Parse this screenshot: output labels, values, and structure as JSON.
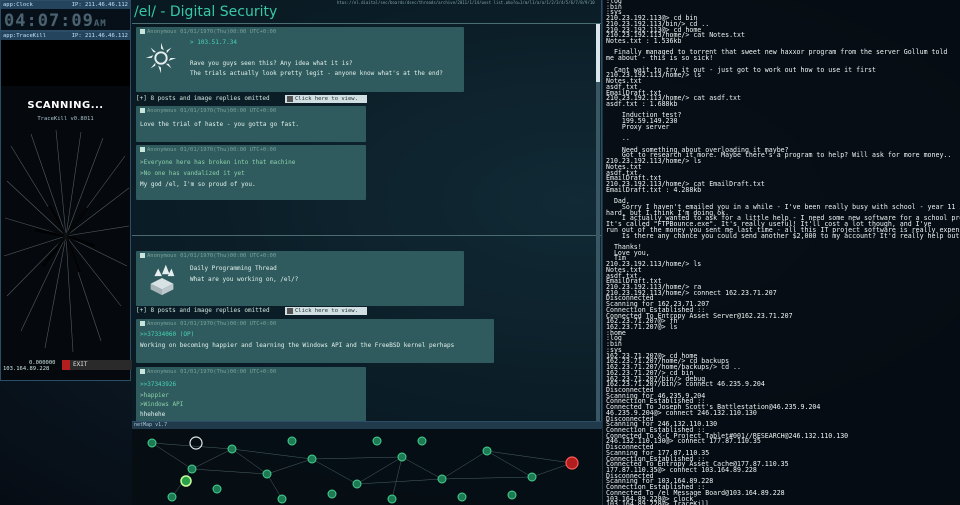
{
  "clock_module": {
    "title": "app:Clock",
    "ip": "IP: 211.46.46.112",
    "time": "04:07:09",
    "ampm": "AM"
  },
  "trace_module": {
    "title": "app:TraceKill",
    "ip": "IP: 211.46.46.112",
    "scanning": "SCANNING...",
    "version": "TraceKill v0.8011",
    "value": "0.000000",
    "ip_footer": "103.164.89.228",
    "exit": "EXIT"
  },
  "web": {
    "board_title": "/el/ - Digital Security",
    "url_strip": "htps://el.digital/sec/boards/dsec/threads/archive/2011/1/14/post_list.php?q=1/m/l1/a/a/1/2/3/4/5/6/7/8/9/10",
    "posts": [
      {
        "meta": "Anonymous 01/01/1970(Thu)00:00 UTC+0:00",
        "id": "> 103.51.7.34",
        "lines": [
          "Rave you guys seen this? Any idea what it is?",
          "The trials actually look pretty legit - anyone know what's at the end?"
        ]
      },
      {
        "meta": "Anonymous 01/01/1970(Thu)00:00 UTC+0:00",
        "lines": [
          "Love the trial of haste - you gotta go fast."
        ]
      },
      {
        "meta": "Anonymous 01/01/1970(Thu)00:00 UTC+0:00",
        "green": [
          ">Everyone here has broken into that machine",
          ">No one has vandalized it yet"
        ],
        "lines": [
          "My god /el, I'm so proud of you."
        ]
      },
      {
        "meta": "Anonymous 01/01/1970(Thu)00:00 UTC+0:00",
        "lines": [
          "Daily Programming Thread",
          "What are you working on, /el/?"
        ]
      },
      {
        "meta": "Anonymous 01/01/1970(Thu)00:00 UTC+0:00",
        "id": ">>37334060 (OP)",
        "lines": [
          "Working on becoming happier and learning the Windows API and the FreeBSD kernel perhaps"
        ]
      },
      {
        "meta": "Anonymous 01/01/1970(Thu)00:00 UTC+0:00",
        "id": ">>37343926",
        "green": [
          ">happier",
          ">Windows API"
        ],
        "lines": [
          "hhehehe"
        ]
      }
    ],
    "omitted": "[+] 8 posts and image replies omitted",
    "view_button": "Click here to view."
  },
  "netmap": {
    "title": "netMap v1.7"
  },
  "terminal": {
    "lines": [
      ":log",
      ":bin",
      ":sys",
      "210.23.192.113@> cd bin",
      "210.23.192.113/bin/> cd ..",
      "210.23.192.113@> cd home",
      "210.23.192.113/home/> cat Notes.txt",
      "Notes.txt : 1.536kb",
      "",
      "  Finally managed to torrent that sweet new haxxor program from the server Gollum told",
      "me about - this is so sick!",
      "",
      "  Cant wait to try it out - just got to work out how to use it first",
      "210.23.192.113/home/> ls",
      "Notes.txt",
      "asdf.txt",
      "EmailDraft.txt",
      "210.23.192.113/home/> cat asdf.txt",
      "asdf.txt : 1.688kb",
      "",
      "    Induction test?",
      "    199.59.149.230",
      "    Proxy server",
      "",
      "    ..",
      "",
      "    Need something about overloading it maybe?",
      "    Got to research it more. Maybe there's a program to help? Will ask for more money..",
      "210.23.192.113/home/> ls",
      "Notes.txt",
      "asdf.txt",
      "EmailDraft.txt",
      "210.23.192.113/home/> cat EmailDraft.txt",
      "EmailDraft.txt : 4.288kb",
      "",
      "  Dad,",
      "    Sorry I haven't emailed you in a while - I've been really busy with school - year 11 is",
      "hard, but I think I'm doing ok.",
      "    I actually wanted to ask for a little help - I need some new software for a school project",
      "It's called \"FTPBounce.exe\". It's really useful! It'll cost a lot though, and I've",
      "run out of the money you sent me last time - all this IT project software is really expensive",
      "    Is there any chance you could send another $2,000 to my account? It'd really help out.",
      "",
      "  Thanks!",
      "  Love you,",
      "  Tim",
      "210.23.192.113/home/> ls",
      "Notes.txt",
      "asdf.txt",
      "EmailDraft.txt",
      "210.23.192.113/home/> ra",
      "210.23.192.113/home/> connect 162.23.71.207",
      "Disconnected",
      "Scanning for 162.23.71.207",
      "Connection Established ::",
      "Connected To Entropy Asset Server@162.23.71.207",
      "162.23.71.207@> fh",
      "162.23.71.207@> ls",
      ":home",
      ":log",
      ":bin",
      ":sys",
      "162.23.71.207@> cd home",
      "162.23.71.207/home/> cd backups",
      "162.23.71.207/home/backups/> cd ..",
      "162.23.71.207/> cd bin",
      "162.23.71.207/bin/> debug",
      "162.23.71.207/bin/> connect 46.235.9.204",
      "Disconnected",
      "Scanning for 46.235.9.204",
      "Connection Established ::",
      "Connected To Joseph Scott's Battlestation@46.235.9.204",
      "46.235.9.204@> connect 246.132.110.130",
      "Disconnected",
      "Scanning for 246.132.110.130",
      "Connection Established ::",
      "Connected To X-C Project Tablet#001//RESEARCH@246.132.110.130",
      "246.132.110.130@> connect 177.87.110.35",
      "Disconnected",
      "Scanning for 177.87.110.35",
      "Connection Established ::",
      "Connected To Entropy Asset Cache@177.87.110.35",
      "177.87.110.35@> connect 103.164.89.228",
      "Disconnected",
      "Scanning for 103.164.89.228",
      "Connection Established ::",
      "Connected To /el Message Board@103.164.89.228",
      "103.164.89.228@> clock",
      "103.164.89.228@> TraceKill"
    ]
  }
}
